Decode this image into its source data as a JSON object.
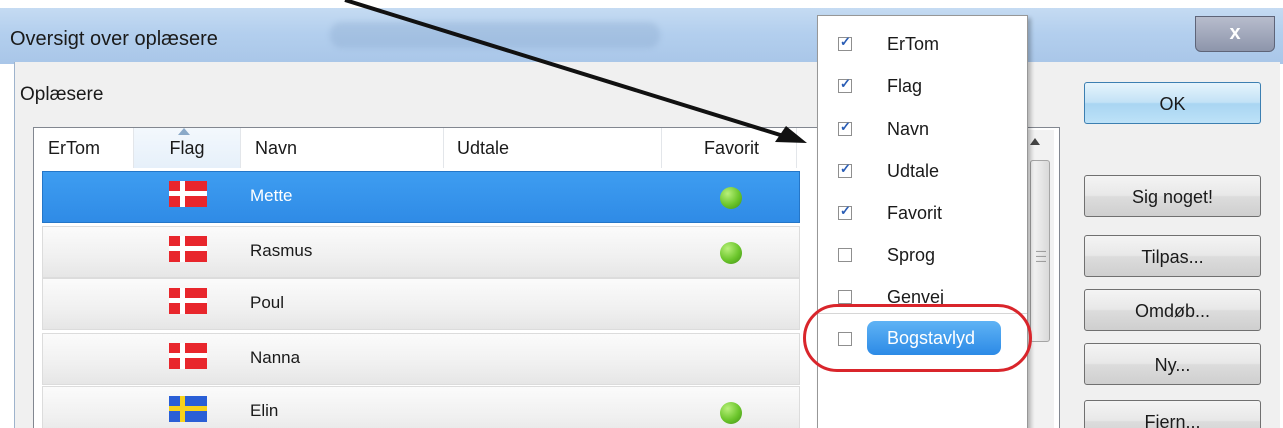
{
  "window": {
    "title": "Oversigt over oplæsere",
    "close_glyph": "x"
  },
  "group": {
    "label": "Oplæsere"
  },
  "list": {
    "columns": [
      {
        "label": "ErTom"
      },
      {
        "label": "Flag",
        "sorted": true
      },
      {
        "label": "Navn"
      },
      {
        "label": "Udtale"
      },
      {
        "label": "Favorit"
      }
    ],
    "rows": [
      {
        "name": "Mette",
        "flag": "danish-flag-icon",
        "favorite": true,
        "selected": true
      },
      {
        "name": "Rasmus",
        "flag": "danish-flag-icon",
        "favorite": true,
        "selected": false
      },
      {
        "name": "Poul",
        "flag": "danish-flag-icon",
        "favorite": false,
        "selected": false
      },
      {
        "name": "Nanna",
        "flag": "danish-flag-icon",
        "favorite": false,
        "selected": false
      },
      {
        "name": "Elin",
        "flag": "swedish-flag-icon",
        "favorite": true,
        "selected": false
      }
    ]
  },
  "buttons": {
    "ok": "OK",
    "say_something": "Sig noget!",
    "customize": "Tilpas...",
    "rename": "Omdøb...",
    "new": "Ny...",
    "remove": "Fjern..."
  },
  "column_menu": {
    "items": [
      {
        "label": "ErTom",
        "checked": true
      },
      {
        "label": "Flag",
        "checked": true
      },
      {
        "label": "Navn",
        "checked": true
      },
      {
        "label": "Udtale",
        "checked": true
      },
      {
        "label": "Favorit",
        "checked": true
      },
      {
        "label": "Sprog",
        "checked": false
      },
      {
        "label": "Genvej",
        "checked": false
      },
      {
        "label": "Bogstavlyd",
        "checked": false,
        "highlighted": true
      }
    ]
  },
  "colors": {
    "selection": "#2f8be6",
    "callout": "#d9252b",
    "favorite_dot": "#6bc52b",
    "danish_red": "#e8262c",
    "swedish_blue": "#2a5fd6",
    "swedish_yellow": "#f7d21a"
  }
}
